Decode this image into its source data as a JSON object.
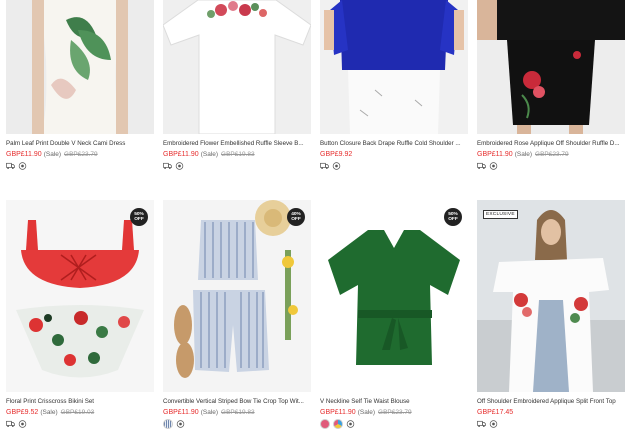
{
  "products": [
    {
      "title": "Palm Leaf Print Double V Neck Cami Dress",
      "price": "GBP£11.90",
      "sale": "(Sale)",
      "old": "GBP£23.79",
      "badge_top": "",
      "badge_bottom": "",
      "tag": "",
      "icons": [
        "truck-icon",
        "cod-icon"
      ]
    },
    {
      "title": "Embroidered Flower Embellished Ruffle Sleeve B...",
      "price": "GBP£11.90",
      "sale": "(Sale)",
      "old": "GBP£19.83",
      "badge_top": "",
      "badge_bottom": "",
      "tag": "",
      "icons": [
        "truck-icon",
        "cod-icon"
      ]
    },
    {
      "title": "Button Closure Back Drape Ruffle Cold Shoulder ...",
      "price": "GBP£9.92",
      "sale": "",
      "old": "",
      "badge_top": "",
      "badge_bottom": "",
      "tag": "",
      "icons": [
        "truck-icon",
        "cod-icon"
      ]
    },
    {
      "title": "Embroidered Rose Applique Off Shoulder Ruffle D...",
      "price": "GBP£11.90",
      "sale": "(Sale)",
      "old": "GBP£23.79",
      "badge_top": "",
      "badge_bottom": "",
      "tag": "",
      "icons": [
        "truck-icon",
        "cod-icon"
      ]
    },
    {
      "title": "Floral Print Crisscross Bikini Set",
      "price": "GBP£9.52",
      "sale": "(Sale)",
      "old": "GBP£19.03",
      "badge_top": "50%",
      "badge_bottom": "OFF",
      "tag": "",
      "icons": [
        "truck-icon",
        "cod-icon"
      ]
    },
    {
      "title": "Convertible Vertical Striped Bow Tie Crop Top Wit...",
      "price": "GBP£11.90",
      "sale": "(Sale)",
      "old": "GBP£19.83",
      "badge_top": "40%",
      "badge_bottom": "OFF",
      "tag": "",
      "icons": [
        "swatch-icon",
        "cod-icon"
      ]
    },
    {
      "title": "V Neckline Self Tie Waist Blouse",
      "price": "GBP£11.90",
      "sale": "(Sale)",
      "old": "GBP£23.79",
      "badge_top": "50%",
      "badge_bottom": "OFF",
      "tag": "",
      "icons": [
        "swatch-red-icon",
        "swatch-multi-icon",
        "cod-icon"
      ]
    },
    {
      "title": "Off Shoulder Embroidered Applique Split Front Top",
      "price": "GBP£17.45",
      "sale": "",
      "old": "",
      "badge_top": "",
      "badge_bottom": "",
      "tag": "EXCLUSIVE",
      "icons": [
        "truck-icon",
        "cod-icon"
      ]
    }
  ],
  "colors": {
    "price": "#e62e2e",
    "old_price": "#999999",
    "badge_bg": "#222222"
  }
}
